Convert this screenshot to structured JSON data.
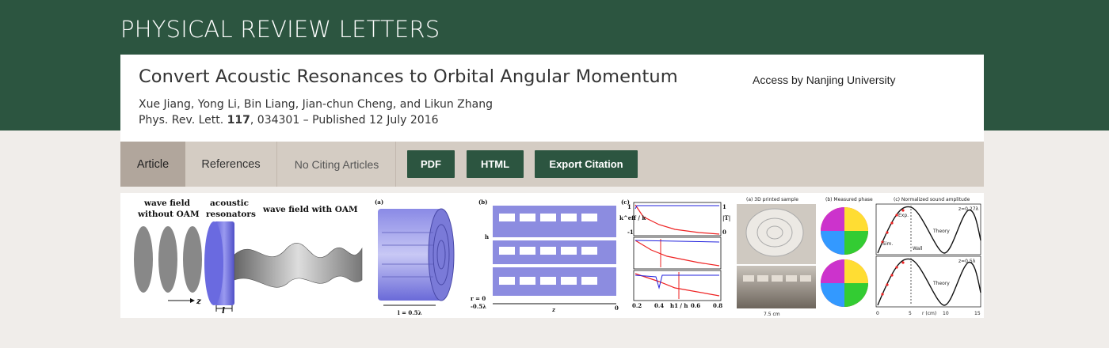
{
  "journal": {
    "name": "PHYSICAL REVIEW LETTERS"
  },
  "article": {
    "title": "Convert Acoustic Resonances to Orbital Angular Momentum",
    "access": "Access by Nanjing University",
    "authors": "Xue Jiang, Yong Li, Bin Liang, Jian-chun Cheng, and Likun Zhang",
    "citation": {
      "journal_abbrev": "Phys. Rev. Lett.",
      "volume": "117",
      "rest": ", 034301 – Published 12 July 2016"
    }
  },
  "tabs": [
    {
      "label": "Article",
      "active": true
    },
    {
      "label": "References",
      "active": false
    },
    {
      "label": "No Citing Articles",
      "active": false
    }
  ],
  "buttons": {
    "pdf": "PDF",
    "html": "HTML",
    "export": "Export Citation"
  },
  "figure": {
    "left": {
      "wave_without": [
        "wave field",
        "without OAM"
      ],
      "resonators": [
        "acoustic",
        "resonators"
      ],
      "wave_with": "wave field with OAM",
      "z_label": "z",
      "l_label": "l"
    },
    "middle": {
      "panel_a": "(a)",
      "panel_b": "(b)",
      "panel_c": "(c)",
      "length_label": "l = 0.5λ",
      "r_label": "r = 0",
      "r_tick": "-0.5λ",
      "z_label": "z",
      "zero": "0",
      "h_label": "h",
      "c_x_ticks": [
        "0.2",
        "0.4",
        "0.6",
        "0.8"
      ],
      "c_x_label": "h1 / h",
      "c_left_ticks": [
        "1",
        "0",
        "-1"
      ],
      "c_right_ticks": [
        "1",
        "0"
      ],
      "keff": "k^eff / k",
      "T": "|T|"
    },
    "right": {
      "title_a": "(a) 3D printed sample",
      "title_b": "(b) Measured phase",
      "title_c": "(c) Normalized sound amplitude",
      "scale": "7.5 cm",
      "z1": "z=0.27λ",
      "z2": "z=0.5λ",
      "theory": "Theory",
      "exp": "Exp.",
      "sim": "Sim.",
      "wall": "Wall",
      "x_label": "r (cm)",
      "x_ticks": [
        "0",
        "5",
        "10",
        "15"
      ]
    }
  }
}
